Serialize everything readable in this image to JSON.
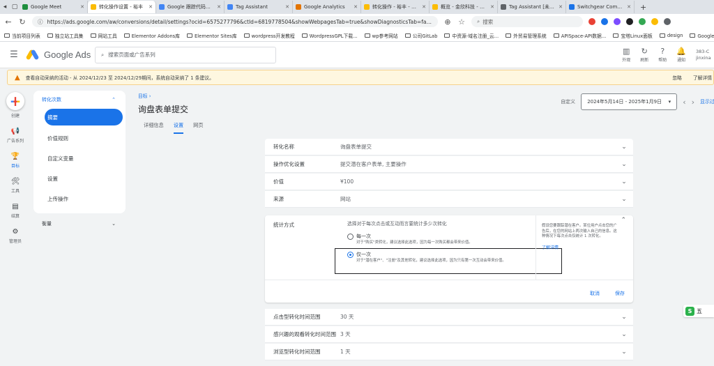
{
  "browser": {
    "tabs": [
      {
        "title": "Google Meet",
        "color": "#1e8e3e",
        "active": false
      },
      {
        "title": "转化操作设置 - 裕丰",
        "color": "#fbbc04",
        "active": true
      },
      {
        "title": "Google 跟踪代码管理器",
        "color": "#4285f4",
        "active": false
      },
      {
        "title": "Tag Assistant",
        "color": "#4285f4",
        "active": false
      },
      {
        "title": "Google Analytics",
        "color": "#e37400",
        "active": false
      },
      {
        "title": "转化操作 - 裕丰 - Goo",
        "color": "#fbbc04",
        "active": false
      },
      {
        "title": "概览 - 金欣科技 - Goo",
        "color": "#fbbc04",
        "active": false
      },
      {
        "title": "Tag Assistant [未连接]",
        "color": "#5f6368",
        "active": false
      },
      {
        "title": "Switchgear Componen",
        "color": "#1a73e8",
        "active": false
      }
    ],
    "url": "https://ads.google.com/aw/conversions/detail/settings?ocid=6575277796&ctId=6819778504&showWebpagesTab=true&showDiagnosticsTab=false...",
    "search_placeholder": "搜索",
    "bookmarks": [
      "当前项目列表",
      "独立站工具集",
      "网站工具",
      "Elementor Addons库",
      "Elementor Sites库",
      "wordpress开发教程",
      "WordpressGPL下载...",
      "wp参考网站",
      "公司GitLab",
      "中资源-域名注册_云...",
      "外贸易管理系统",
      "APISpace-API数据...",
      "宝塔Linux面板",
      "design",
      "Google 翻译"
    ]
  },
  "header": {
    "product": "Google Ads",
    "search_placeholder": "搜索页面或广告系列",
    "tools": [
      {
        "icon": "chart-icon",
        "glyph": "▥",
        "label": "外观"
      },
      {
        "icon": "refresh-icon",
        "glyph": "↻",
        "label": "刷新"
      },
      {
        "icon": "help-icon",
        "glyph": "?",
        "label": "帮助"
      },
      {
        "icon": "bell-icon",
        "glyph": "🔔",
        "label": "通知"
      }
    ],
    "account_id": "383-C",
    "account_name": "jinxinad"
  },
  "warning": {
    "text": "查看自动采纳的活动 - 从 2024/12/23 至 2024/12/29期间，系统自动采纳了 1 条建议。",
    "dismiss": "忽略",
    "details": "了解详情"
  },
  "rail": {
    "create": "创建",
    "items": [
      {
        "label": "广告系列",
        "glyph": "📢"
      },
      {
        "label": "目标",
        "glyph": "🏆",
        "active": true
      },
      {
        "label": "工具",
        "glyph": "🛠"
      },
      {
        "label": "结算",
        "glyph": "▤"
      },
      {
        "label": "管理员",
        "glyph": "⚙"
      }
    ]
  },
  "subnav": {
    "section": "转化次数",
    "items": [
      "摘要",
      "价值规则",
      "自定义变量",
      "设置",
      "上传操作"
    ],
    "measure": "衡量"
  },
  "page": {
    "breadcrumb": "目标 ›",
    "title": "询盘表单提交",
    "tabs": [
      "详细信息",
      "设置",
      "网页"
    ],
    "date_label": "自定义",
    "date_range": "2024年5月14日 - 2025年1月9日",
    "show_label": "显示过去"
  },
  "rows": [
    {
      "key": "转化名称",
      "value": "询盘表单提交"
    },
    {
      "key": "操作优化设置",
      "value": "提交潜在客户表单, 主要操作"
    },
    {
      "key": "价值",
      "value": "¥100"
    },
    {
      "key": "来源",
      "value": "网站"
    }
  ],
  "counting": {
    "key": "统计方式",
    "question": "选择对于每次点击或互动而言要统计多少次转化",
    "options": [
      {
        "title": "每一次",
        "desc": "对于\"购买\"类转化，建议选择此选项，因为每一次购买都会带来价值。",
        "selected": false
      },
      {
        "title": "仅一次",
        "desc": "对于\"潜在客户\"、\"注册\"及其他转化，建议选择此选项，因为只有第一次互动会带来价值。",
        "selected": true
      }
    ],
    "help": "假设您要跟踪潜在客户。某位用户点击您的广告后，在您的网站上两次输入自己的信息。这种情况下每次点击仅统计 1 次转化。",
    "learn_more": "了解详情",
    "cancel": "取消",
    "save": "保存"
  },
  "rows_after": [
    {
      "key": "点击型转化时间范围",
      "value": "30 天"
    },
    {
      "key": "感兴趣的观看转化时间范围",
      "value": "3 天"
    },
    {
      "key": "浏览型转化时间范围",
      "value": "1 天"
    }
  ],
  "floating_widget": {
    "badge": "S",
    "text": "五"
  }
}
